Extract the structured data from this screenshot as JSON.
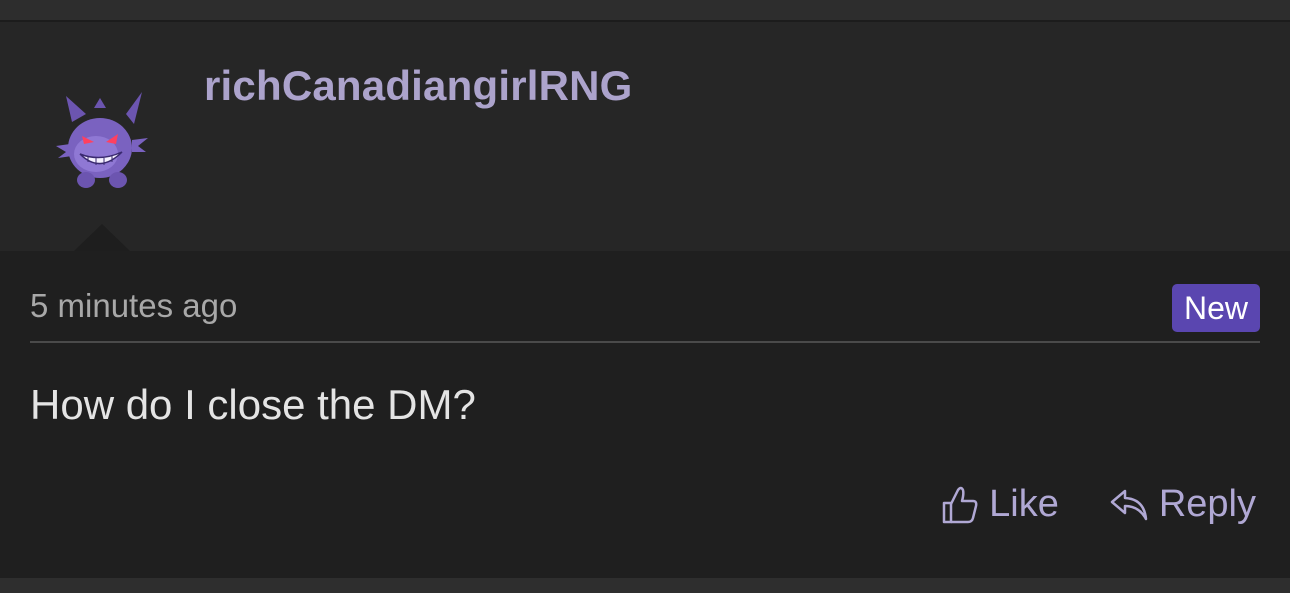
{
  "comment": {
    "username": "richCanadiangirlRNG",
    "avatar_icon": "gengar-avatar-icon",
    "timestamp": "5 minutes ago",
    "badge": "New",
    "message": "How do I close the DM?"
  },
  "actions": {
    "like_label": "Like",
    "like_icon": "thumbs-up-icon",
    "reply_label": "Reply",
    "reply_icon": "reply-arrow-icon"
  },
  "colors": {
    "username": "#aca3cc",
    "badge_bg": "#5a46b0",
    "action": "#b0a8d4",
    "header_bg": "#262626",
    "body_bg": "#1f1f1f"
  }
}
